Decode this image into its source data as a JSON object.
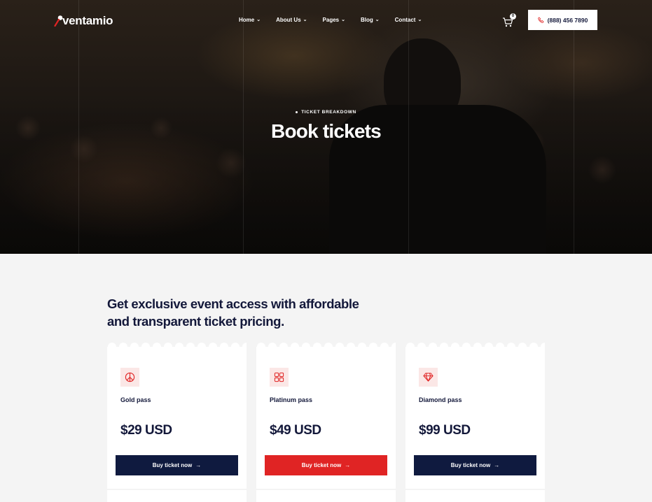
{
  "brand": {
    "name": "ventamio",
    "logo_letter": "ventamio"
  },
  "nav": {
    "items": [
      {
        "label": "Home"
      },
      {
        "label": "About Us"
      },
      {
        "label": "Pages"
      },
      {
        "label": "Blog"
      },
      {
        "label": "Contact"
      }
    ],
    "cart_count": "0",
    "phone": "(888) 456 7890"
  },
  "hero": {
    "eyebrow": "TICKET BREAKDOWN",
    "title": "Book tickets"
  },
  "intro": {
    "line1": "Get exclusive event access with affordable",
    "line2": "and transparent ticket pricing."
  },
  "plans": [
    {
      "icon": "peace-icon",
      "name": "Gold pass",
      "price": "$29 USD",
      "button": "Buy ticket now"
    },
    {
      "icon": "grid-icon",
      "name": "Platinum pass",
      "price": "$49 USD",
      "button": "Buy ticket now"
    },
    {
      "icon": "diamond-icon",
      "name": "Diamond pass",
      "price": "$99 USD",
      "button": "Buy ticket now"
    }
  ],
  "colors": {
    "navy": "#0f1a3f",
    "accent_red": "#e02424",
    "icon_bg": "#fbe7e6",
    "page_bg": "#f4f4f4"
  }
}
